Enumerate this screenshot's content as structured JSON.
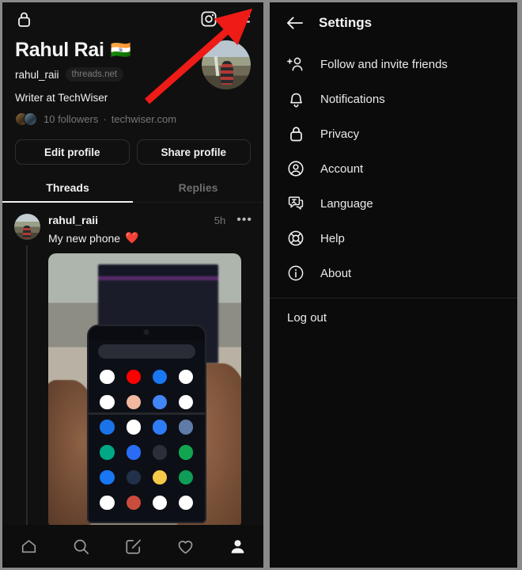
{
  "profile": {
    "lock_icon": "lock-icon",
    "instagram_icon": "instagram-icon",
    "menu_icon": "hamburger-menu-icon",
    "display_name": "Rahul Rai",
    "flag": "🇮🇳",
    "handle": "rahul_raii",
    "handle_badge": "threads.net",
    "bio": "Writer at TechWiser",
    "followers": "10 followers",
    "separator": "·",
    "website": "techwiser.com",
    "edit_button": "Edit profile",
    "share_button": "Share profile"
  },
  "tabs": [
    {
      "label": "Threads",
      "active": true
    },
    {
      "label": "Replies",
      "active": false
    }
  ],
  "post": {
    "username": "rahul_raii",
    "time": "5h",
    "more": "•••",
    "text": "My new phone",
    "emoji": "❤️",
    "image_alt": "photo-of-foldable-phone-app-drawer"
  },
  "bottom_nav": [
    {
      "name": "home-icon",
      "active": false
    },
    {
      "name": "search-icon",
      "active": false
    },
    {
      "name": "compose-icon",
      "active": false
    },
    {
      "name": "heart-icon",
      "active": false
    },
    {
      "name": "profile-icon",
      "active": true
    }
  ],
  "settings": {
    "back_icon": "back-arrow-icon",
    "title": "Settings",
    "items": [
      {
        "label": "Follow and invite friends",
        "icon": "add-person-icon"
      },
      {
        "label": "Notifications",
        "icon": "bell-icon"
      },
      {
        "label": "Privacy",
        "icon": "lock-icon"
      },
      {
        "label": "Account",
        "icon": "account-circle-icon"
      },
      {
        "label": "Language",
        "icon": "language-icon"
      },
      {
        "label": "Help",
        "icon": "life-ring-icon"
      },
      {
        "label": "About",
        "icon": "info-circle-icon"
      }
    ],
    "logout": "Log out"
  },
  "annotation": {
    "arrow_color": "#ee1b17",
    "arrow_target": "hamburger-menu-icon"
  },
  "colors": {
    "background": "#101010",
    "panel_background": "#0b0b0b",
    "text_primary": "#f2f2f2",
    "text_muted": "#777777",
    "divider": "#242424",
    "outer_border": "#8a8a8a"
  }
}
